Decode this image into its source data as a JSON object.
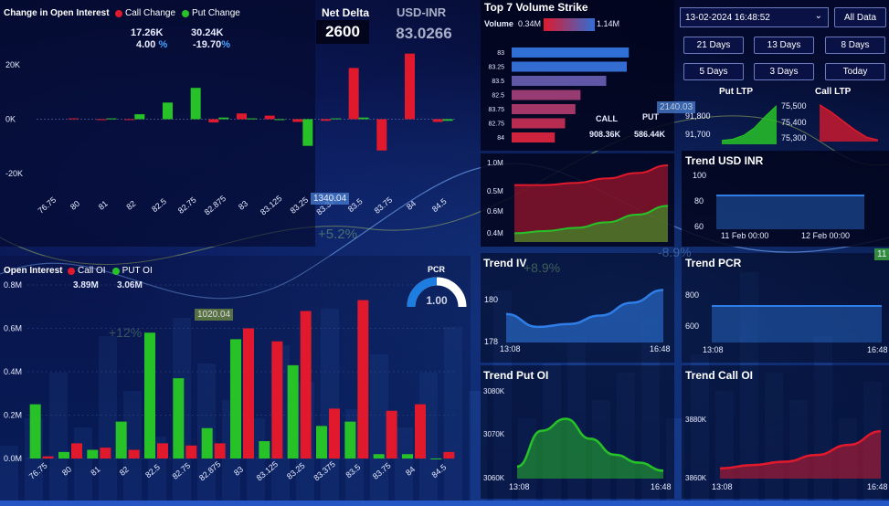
{
  "colors": {
    "call": "#e0192c",
    "put": "#27c227",
    "accent": "#4aa3ff",
    "bar_blue": "#2f6fd6"
  },
  "change_oi": {
    "title": "Change in Open Interest",
    "legend_call": "Call Change",
    "legend_put": "Put Change",
    "call_value": "17.26K",
    "put_value": "30.24K",
    "call_pct": "4.00",
    "put_pct": "-19.70",
    "pct_sign": "%",
    "y_ticks": [
      "20K",
      "0K",
      "-20K"
    ],
    "categories": [
      "76.75",
      "80",
      "81",
      "82",
      "82.5",
      "82.75",
      "82.875",
      "83",
      "83.125",
      "83.25",
      "83.375",
      "83.5",
      "83.75",
      "84",
      "84.5"
    ]
  },
  "net_delta": {
    "label": "Net Delta",
    "value": "2600"
  },
  "usd_inr": {
    "label": "USD-INR",
    "value": "83.0266"
  },
  "top7": {
    "title": "Top 7 Volume Strike",
    "volume_label": "Volume",
    "min": "0.34M",
    "max": "1.14M",
    "call_label": "CALL",
    "put_label": "PUT",
    "call_value": "908.36K",
    "put_value": "586.44K"
  },
  "controls": {
    "datetime": "13-02-2024 16:48:52",
    "all_data": "All Data",
    "buttons": [
      "21 Days",
      "13 Days",
      "8 Days",
      "5 Days",
      "3 Days",
      "Today"
    ]
  },
  "ltp": {
    "put_title": "Put LTP",
    "call_title": "Call LTP",
    "put_ticks": [
      "91,800",
      "91,700"
    ],
    "call_ticks": [
      "75,500",
      "75,400",
      "75,300"
    ]
  },
  "vol_trend": {
    "ticks": [
      "1.0M",
      "0.5M",
      "0.6M",
      "0.4M"
    ]
  },
  "trend_usd": {
    "title": "Trend USD INR",
    "ticks": [
      "100",
      "80",
      "60"
    ],
    "x_labels": [
      "11 Feb 00:00",
      "12 Feb 00:00"
    ]
  },
  "open_interest": {
    "title": "Open Interest",
    "legend_call": "Call OI",
    "legend_put": "PUT OI",
    "call_value": "3.89M",
    "put_value": "3.06M",
    "y_ticks": [
      "0.8M",
      "0.6M",
      "0.4M",
      "0.2M",
      "0.0M"
    ]
  },
  "pcr": {
    "label": "PCR",
    "value": "1.00"
  },
  "trend_iv": {
    "title": "Trend IV",
    "ticks": [
      "180",
      "178"
    ],
    "x_start": "13:08",
    "x_end": "16:48"
  },
  "trend_pcr": {
    "title": "Trend PCR",
    "ticks": [
      "800",
      "600"
    ],
    "x_start": "13:08",
    "x_end": "16:48"
  },
  "trend_put_oi": {
    "title": "Trend Put OI",
    "ticks": [
      "3080K",
      "3070K",
      "3060K"
    ],
    "x_start": "13:08",
    "x_end": "16:48"
  },
  "trend_call_oi": {
    "title": "Trend Call OI",
    "ticks": [
      "3880K",
      "3860K"
    ],
    "x_start": "13:08",
    "x_end": "16:48"
  },
  "overlay": {
    "labels": [
      "1340.04",
      "2140.03",
      "1020.04",
      "+5.2%",
      "+8.9%",
      "+12%",
      "-8.9%",
      "11"
    ]
  },
  "chart_data": [
    {
      "type": "bar",
      "name": "change-in-oi",
      "categories": [
        "76.75",
        "80",
        "81",
        "82",
        "82.5",
        "82.75",
        "82.875",
        "83",
        "83.125",
        "83.25",
        "83.375",
        "83.5",
        "83.75",
        "84",
        "84.5"
      ],
      "series": [
        {
          "name": "Call Change",
          "values": [
            0,
            0.3,
            -0.3,
            -0.3,
            0,
            0,
            -1.2,
            2.1,
            1.3,
            -1,
            -0.6,
            18.8,
            -11.5,
            24.1,
            -1
          ]
        },
        {
          "name": "Put Change",
          "values": [
            0,
            0,
            0.3,
            1.8,
            6.1,
            11.5,
            0.6,
            0.3,
            -0.3,
            -9.8,
            0.3,
            0.6,
            0,
            0,
            -0.6
          ]
        }
      ],
      "ylim": [
        -25,
        27
      ],
      "title": "Change in Open Interest"
    },
    {
      "type": "bar",
      "name": "open-interest",
      "categories": [
        "76.75",
        "80",
        "81",
        "82",
        "82.5",
        "82.75",
        "82.875",
        "83",
        "83.125",
        "83.25",
        "83.375",
        "83.5",
        "83.75",
        "84",
        "84.5"
      ],
      "series": [
        {
          "name": "Call OI",
          "values": [
            0.01,
            0.07,
            0.05,
            0.04,
            0.07,
            0.06,
            0.07,
            0.6,
            0.54,
            0.68,
            0.23,
            0.73,
            0.22,
            0.25,
            0.03
          ],
          "extra_values": [
            0,
            0,
            0,
            0,
            0,
            0,
            0,
            0,
            0,
            0,
            0,
            0,
            0,
            0,
            0
          ]
        },
        {
          "name": "PUT OI",
          "values": [
            0.25,
            0.03,
            0.04,
            0.17,
            0.58,
            0.37,
            0.14,
            0.55,
            0.08,
            0.43,
            0.15,
            0.17,
            0.02,
            0.02,
            0
          ],
          "extra_values": [
            0,
            0,
            0,
            0,
            0,
            0,
            0,
            0,
            0,
            0,
            0,
            0,
            0,
            0,
            0
          ]
        }
      ],
      "ylim": [
        0,
        0.8
      ],
      "title": "Open Interest"
    },
    {
      "type": "bar",
      "name": "top7-volume",
      "categories": [
        "83",
        "83.25",
        "83.5",
        "82.5",
        "83.75",
        "82.75",
        "84"
      ],
      "values": [
        1.14,
        1.12,
        0.92,
        0.67,
        0.62,
        0.52,
        0.42
      ],
      "xlim": [
        0,
        1.2
      ]
    },
    {
      "type": "area",
      "name": "volume-trend",
      "series": [
        {
          "name": "CALL",
          "values": [
            0.82,
            0.82,
            0.84,
            0.88,
            0.93,
            1.0
          ]
        },
        {
          "name": "PUT",
          "values": [
            0.38,
            0.4,
            0.43,
            0.48,
            0.55,
            0.63
          ]
        }
      ],
      "ylim": [
        0.3,
        1.05
      ]
    },
    {
      "type": "area",
      "name": "put-ltp",
      "values": [
        91695,
        91700,
        91715,
        91745,
        91790,
        91830
      ],
      "ylim": [
        91680,
        91850
      ]
    },
    {
      "type": "area",
      "name": "call-ltp",
      "values": [
        75530,
        75480,
        75420,
        75360,
        75310,
        75290
      ],
      "ylim": [
        75280,
        75560
      ]
    },
    {
      "type": "area",
      "name": "trend-usd-inr",
      "values": [
        83,
        83,
        83,
        83,
        83,
        83
      ],
      "ylim": [
        55,
        105
      ]
    },
    {
      "type": "area",
      "name": "trend-iv",
      "values": [
        179.5,
        178.6,
        178.8,
        179.4,
        180.3,
        181.2
      ],
      "ylim": [
        177.5,
        182
      ]
    },
    {
      "type": "area",
      "name": "trend-pcr",
      "values": [
        700,
        700,
        700,
        700,
        700,
        700
      ],
      "ylim": [
        500,
        850
      ]
    },
    {
      "type": "area",
      "name": "trend-put-oi",
      "values": [
        3063,
        3072,
        3075,
        3070,
        3066,
        3064,
        3062
      ],
      "ylim": [
        3060,
        3082
      ]
    },
    {
      "type": "area",
      "name": "trend-call-oi",
      "values": [
        3861,
        3862,
        3863,
        3865,
        3868,
        3872
      ],
      "ylim": [
        3858,
        3884
      ]
    }
  ]
}
